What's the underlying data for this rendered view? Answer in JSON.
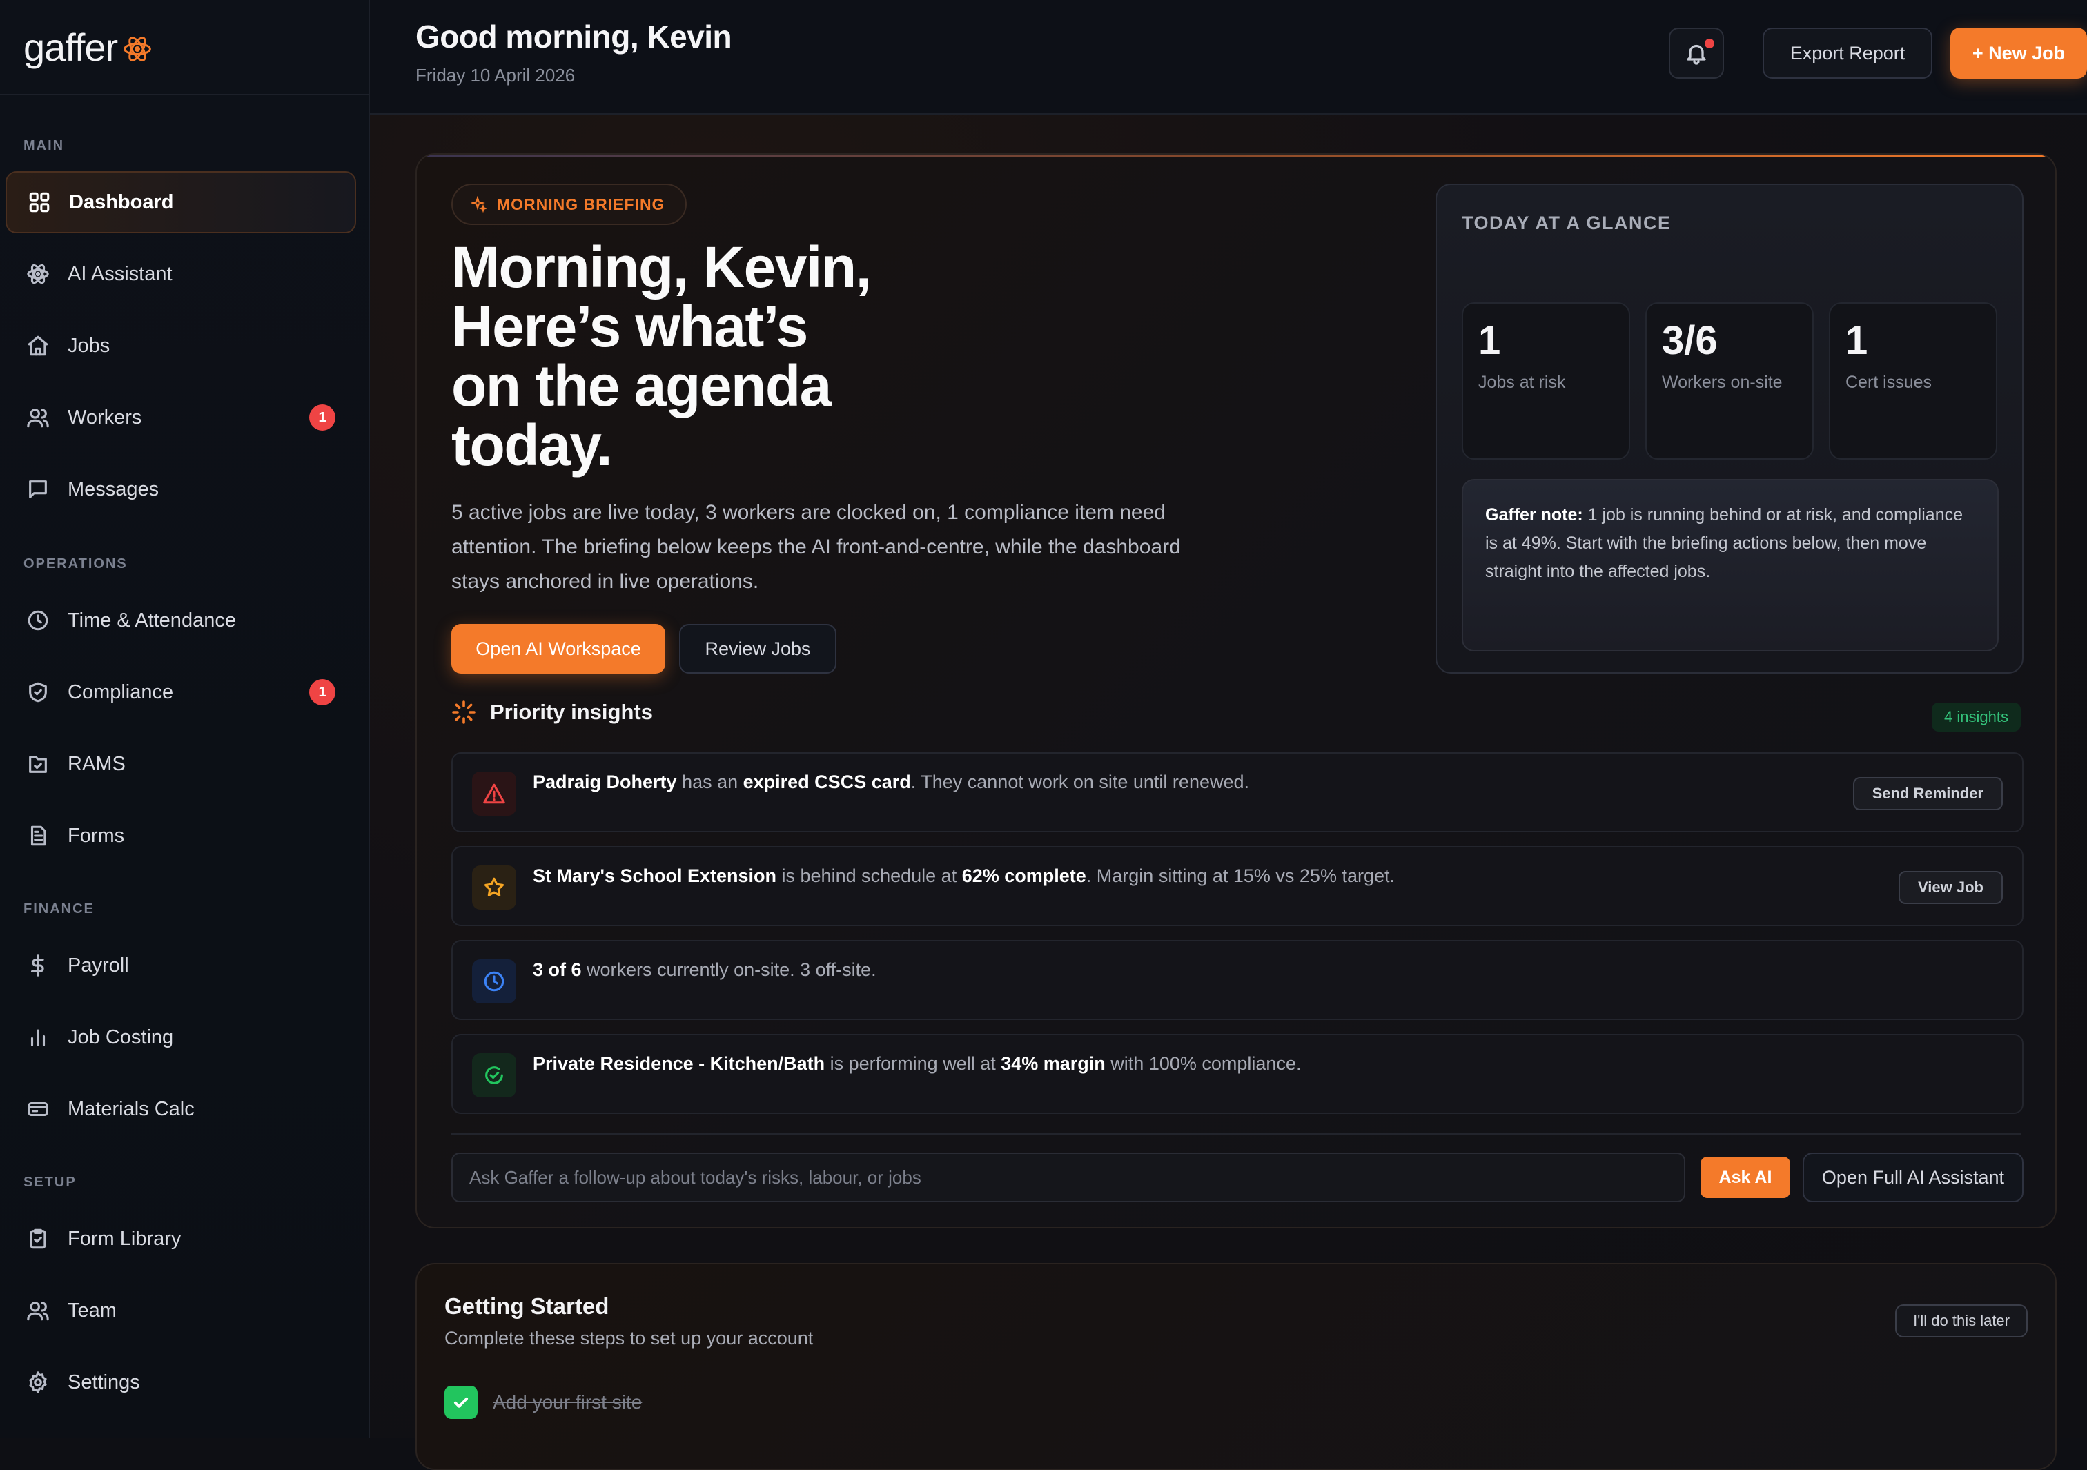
{
  "brand": {
    "name": "gaffer",
    "accent": "#f47a2a"
  },
  "sidebar": {
    "sections": {
      "main": "MAIN",
      "operations": "OPERATIONS",
      "finance": "FINANCE",
      "setup": "SETUP"
    },
    "items": [
      {
        "label": "Dashboard",
        "icon": "grid-icon",
        "active": true
      },
      {
        "label": "AI Assistant",
        "icon": "atom-icon"
      },
      {
        "label": "Jobs",
        "icon": "home-icon"
      },
      {
        "label": "Workers",
        "icon": "users-icon",
        "badge": "1"
      },
      {
        "label": "Messages",
        "icon": "message-icon"
      },
      {
        "label": "Time & Attendance",
        "icon": "clock-icon"
      },
      {
        "label": "Compliance",
        "icon": "shield-icon",
        "badge": "1"
      },
      {
        "label": "RAMS",
        "icon": "file-check-icon"
      },
      {
        "label": "Forms",
        "icon": "document-icon"
      },
      {
        "label": "Payroll",
        "icon": "dollar-icon"
      },
      {
        "label": "Job Costing",
        "icon": "bar-chart-icon"
      },
      {
        "label": "Materials Calc",
        "icon": "card-icon"
      },
      {
        "label": "Form Library",
        "icon": "clipboard-icon"
      },
      {
        "label": "Team",
        "icon": "users-icon"
      },
      {
        "label": "Settings",
        "icon": "gear-icon"
      }
    ]
  },
  "header": {
    "greeting": "Good morning, Kevin",
    "date": "Friday 10 April 2026",
    "export_label": "Export Report",
    "new_job_label": "+ New Job"
  },
  "briefing": {
    "pill": "MORNING BRIEFING",
    "headline_lines": [
      "Morning, Kevin,",
      "Here’s what’s",
      "on the agenda",
      "today."
    ],
    "lead": "5 active jobs are live today, 3 workers are clocked on, 1 compliance item need attention. The briefing below keeps the AI front-and-centre, while the dashboard stays anchored in live operations.",
    "open_ai_label": "Open AI Workspace",
    "review_jobs_label": "Review Jobs"
  },
  "glance": {
    "title": "TODAY AT A GLANCE",
    "stats": [
      {
        "value": "1",
        "label": "Jobs at risk"
      },
      {
        "value": "3/6",
        "label": "Workers on-site"
      },
      {
        "value": "1",
        "label": "Cert issues"
      }
    ],
    "note_label": "Gaffer note:",
    "note_text": " 1 job is running behind or at risk, and compliance is at 49%. Start with the briefing actions below, then move straight into the affected jobs."
  },
  "insights": {
    "title": "Priority insights",
    "count": "4 insights",
    "items": [
      {
        "icon": "warning-icon",
        "color": "#ef4444",
        "parts": [
          [
            "b",
            "Padraig Doherty"
          ],
          [
            "t",
            " has an "
          ],
          [
            "b",
            "expired CSCS card"
          ],
          [
            "t",
            ". They cannot work on site until renewed."
          ]
        ],
        "action": "Send Reminder"
      },
      {
        "icon": "star-icon",
        "color": "#f5a524",
        "parts": [
          [
            "b",
            "St Mary's School Extension"
          ],
          [
            "t",
            " is behind schedule at "
          ],
          [
            "b",
            "62% complete"
          ],
          [
            "t",
            ". Margin sitting at 15% vs 25% target."
          ]
        ],
        "action": "View Job"
      },
      {
        "icon": "clock-icon",
        "color": "#3b82f6",
        "parts": [
          [
            "b",
            "3 of 6"
          ],
          [
            "t",
            " workers currently on-site. 3 off-site."
          ]
        ],
        "action": ""
      },
      {
        "icon": "check-circle-icon",
        "color": "#22c55e",
        "parts": [
          [
            "b",
            "Private Residence - Kitchen/Bath"
          ],
          [
            "t",
            " is performing well at "
          ],
          [
            "b",
            "34% margin"
          ],
          [
            "t",
            " with 100% compliance."
          ]
        ],
        "action": ""
      }
    ]
  },
  "ask": {
    "placeholder": "Ask Gaffer a follow-up about today's risks, labour, or jobs",
    "ask_label": "Ask AI",
    "open_full_label": "Open Full AI Assistant"
  },
  "getting_started": {
    "title": "Getting Started",
    "subtitle": "Complete these steps to set up your account",
    "later_label": "I'll do this later",
    "steps": [
      {
        "label": "Add your first site",
        "done": true
      }
    ]
  }
}
